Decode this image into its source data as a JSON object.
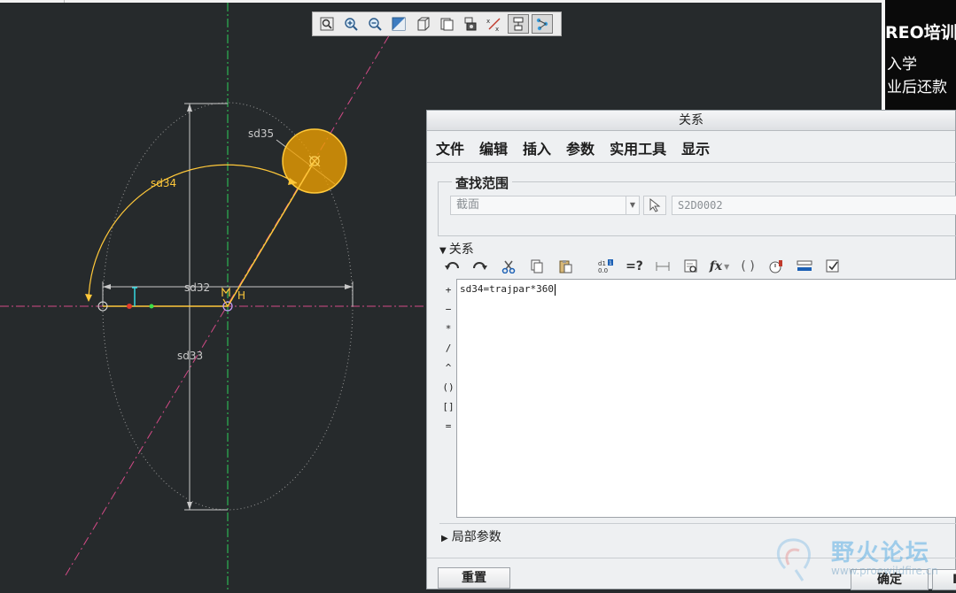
{
  "graphics_toolbar": {
    "icons": [
      "zoom-fit-icon",
      "zoom-in-icon",
      "zoom-out-icon",
      "repaint-icon",
      "shading-icon",
      "saved-views-icon",
      "sketch-view-icon",
      "constraint-display-icon",
      "dimension-display-icon",
      "vertex-display-icon"
    ]
  },
  "sketch": {
    "dimensions": {
      "sd35": "sd35",
      "sd34": "sd34",
      "sd32": "sd32",
      "sd33": "sd33"
    },
    "constraint_label": "H",
    "colors": {
      "background": "#262a2c",
      "sketch_entity": "#ffc83a",
      "circle_fill": "#f0a000",
      "centerline_vertical": "#2fd05a",
      "centerline_diagonal": "#d24a86",
      "dimension": "#c8c8c8"
    }
  },
  "banner": {
    "line1": "REO培训",
    "line2": "入学",
    "line3": "业后还款"
  },
  "dialog": {
    "title": "关系",
    "menu": [
      "文件",
      "编辑",
      "插入",
      "参数",
      "实用工具",
      "显示"
    ],
    "search_scope": {
      "label": "查找范围",
      "scope_value": "截面",
      "section_value": "S2D0002"
    },
    "relations_section_label": "关系",
    "toolbar_icons": [
      "undo-icon",
      "redo-icon",
      "cut-icon",
      "copy-icon",
      "paste-icon",
      "switch-dims-icon",
      "evaluate-icon",
      "insert-dimension-icon",
      "parameter-icon",
      "function-icon",
      "parentheses-icon",
      "verify-icon",
      "sort-icon",
      "check-icon"
    ],
    "operators": [
      "+",
      "−",
      "*",
      "/",
      "^",
      "()",
      "[]",
      "="
    ],
    "relations_text": "sd34=trajpar*360",
    "local_params_label": "局部参数",
    "reset_label": "重置",
    "ok_label": "确定",
    "cancel_label_partial": "I"
  },
  "watermark": {
    "text": "野火论坛",
    "url": "www.proewildfire.cn"
  }
}
